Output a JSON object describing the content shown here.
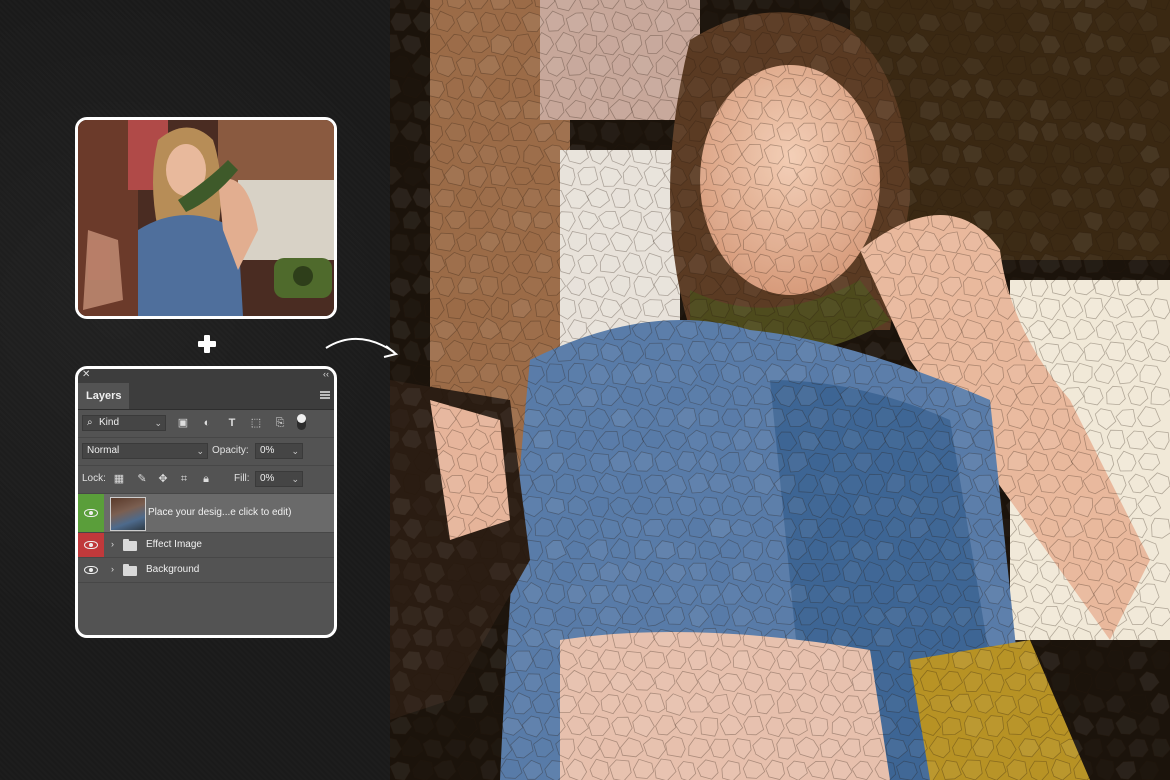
{
  "panel": {
    "tab_label": "Layers",
    "close_glyph": "✕",
    "collapse_glyph": "‹‹",
    "filter": {
      "kind_label": "Kind",
      "icons": [
        "image-filter-icon",
        "adjustment-filter-icon",
        "type-filter-icon",
        "shape-filter-icon",
        "smart-object-filter-icon",
        "filter-toggle-icon"
      ]
    },
    "blend": {
      "mode": "Normal",
      "opacity_label": "Opacity:",
      "opacity_value": "0%"
    },
    "lock": {
      "label": "Lock:",
      "icons": [
        "lock-transparency-icon",
        "lock-paint-icon",
        "lock-position-icon",
        "lock-artboard-icon",
        "lock-all-icon"
      ],
      "fill_label": "Fill:",
      "fill_value": "0%"
    },
    "layers": [
      {
        "name": "Place your desig...e click to edit)",
        "type": "smart-object",
        "selected": true,
        "eye_color": "#5a9e3a"
      },
      {
        "name": "Effect Image",
        "type": "group",
        "selected": false,
        "eye_color": "#c0393b"
      },
      {
        "name": "Background",
        "type": "group",
        "selected": false,
        "eye_color": ""
      }
    ]
  },
  "colors": {
    "background": "#1c1c1c",
    "panel": "#535353",
    "card_border": "#ffffff"
  }
}
